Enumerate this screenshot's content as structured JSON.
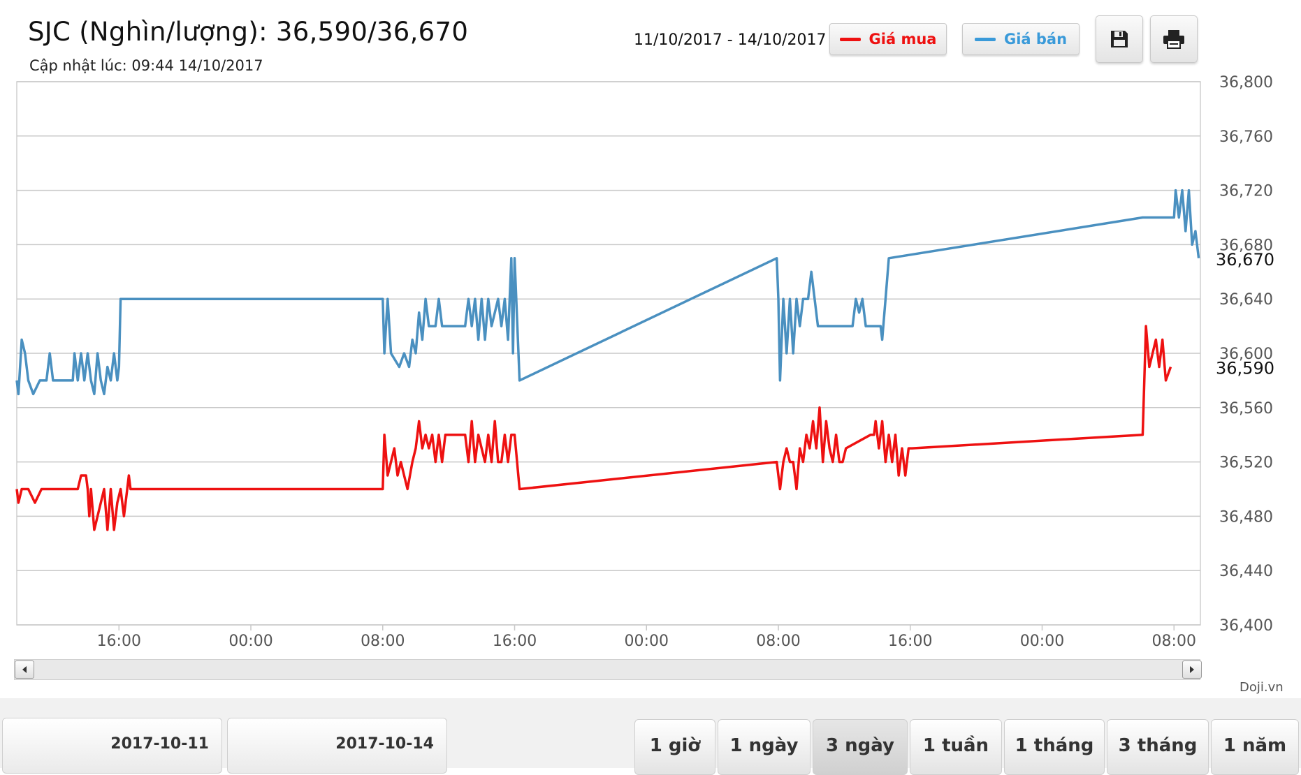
{
  "header": {
    "title": "SJC (Nghìn/lượng): 36,590/36,670",
    "updated": "Cập nhật lúc: 09:44 14/10/2017",
    "date_range": "11/10/2017 - 14/10/2017"
  },
  "legend": {
    "buy_label": "Giá mua",
    "sell_label": "Giá bán",
    "buy_color": "#ee1111",
    "sell_color": "#4a90c0"
  },
  "toolbar": {
    "save_icon": "floppy-disk-icon",
    "print_icon": "printer-icon"
  },
  "credit": "Doji.vn",
  "navigator": {
    "from": "2017-10-11",
    "to": "2017-10-14"
  },
  "range_buttons": [
    "1 giờ",
    "1 ngày",
    "3 ngày",
    "1 tuần",
    "1 tháng",
    "3 tháng",
    "1 năm"
  ],
  "active_range": "3 ngày",
  "chart_data": {
    "type": "line",
    "x_unit": "hours since 2017-10-11 00:00",
    "ylim": [
      36400,
      36800
    ],
    "y_ticks": [
      36400,
      36440,
      36480,
      36520,
      36560,
      36600,
      36640,
      36680,
      36720,
      36760,
      36800
    ],
    "y_tick_labels": [
      "36,400",
      "36,440",
      "36,480",
      "36,520",
      "36,560",
      "36,600",
      "36,640",
      "36,680",
      "36,720",
      "36,760",
      "36,800"
    ],
    "x_ticks": [
      16,
      24,
      32,
      40,
      48,
      56,
      64,
      72,
      80
    ],
    "x_tick_labels": [
      "16:00",
      "00:00",
      "08:00",
      "16:00",
      "00:00",
      "08:00",
      "16:00",
      "00:00",
      "08:00"
    ],
    "x_range": [
      9.8,
      81.6
    ],
    "last_values": {
      "sell": "36,670",
      "buy": "36,590"
    },
    "grid": true,
    "series": [
      {
        "name": "Giá bán",
        "color": "#4a90c0",
        "points": [
          [
            9.8,
            36580
          ],
          [
            9.9,
            36570
          ],
          [
            10.1,
            36610
          ],
          [
            10.3,
            36600
          ],
          [
            10.5,
            36580
          ],
          [
            10.8,
            36570
          ],
          [
            11.2,
            36580
          ],
          [
            11.6,
            36580
          ],
          [
            11.8,
            36600
          ],
          [
            12.0,
            36580
          ],
          [
            13.2,
            36580
          ],
          [
            13.3,
            36600
          ],
          [
            13.5,
            36580
          ],
          [
            13.7,
            36600
          ],
          [
            13.9,
            36580
          ],
          [
            14.1,
            36600
          ],
          [
            14.3,
            36580
          ],
          [
            14.5,
            36570
          ],
          [
            14.7,
            36600
          ],
          [
            14.9,
            36580
          ],
          [
            15.1,
            36570
          ],
          [
            15.3,
            36590
          ],
          [
            15.5,
            36580
          ],
          [
            15.7,
            36600
          ],
          [
            15.9,
            36580
          ],
          [
            16.0,
            36590
          ],
          [
            16.1,
            36640
          ],
          [
            32.0,
            36640
          ],
          [
            32.1,
            36600
          ],
          [
            32.3,
            36640
          ],
          [
            32.5,
            36600
          ],
          [
            33.0,
            36590
          ],
          [
            33.3,
            36600
          ],
          [
            33.6,
            36590
          ],
          [
            33.8,
            36610
          ],
          [
            34.0,
            36600
          ],
          [
            34.2,
            36630
          ],
          [
            34.4,
            36610
          ],
          [
            34.6,
            36640
          ],
          [
            34.8,
            36620
          ],
          [
            35.2,
            36620
          ],
          [
            35.4,
            36640
          ],
          [
            35.6,
            36620
          ],
          [
            37.0,
            36620
          ],
          [
            37.2,
            36640
          ],
          [
            37.4,
            36620
          ],
          [
            37.6,
            36640
          ],
          [
            37.8,
            36610
          ],
          [
            38.0,
            36640
          ],
          [
            38.2,
            36610
          ],
          [
            38.4,
            36640
          ],
          [
            38.6,
            36620
          ],
          [
            39.0,
            36640
          ],
          [
            39.2,
            36620
          ],
          [
            39.4,
            36640
          ],
          [
            39.6,
            36610
          ],
          [
            39.8,
            36670
          ],
          [
            39.9,
            36600
          ],
          [
            40.0,
            36670
          ],
          [
            40.3,
            36580
          ],
          [
            55.9,
            36670
          ],
          [
            56.0,
            36640
          ],
          [
            56.1,
            36580
          ],
          [
            56.3,
            36640
          ],
          [
            56.5,
            36600
          ],
          [
            56.7,
            36640
          ],
          [
            56.9,
            36600
          ],
          [
            57.1,
            36640
          ],
          [
            57.3,
            36620
          ],
          [
            57.5,
            36640
          ],
          [
            57.8,
            36640
          ],
          [
            58.0,
            36660
          ],
          [
            58.2,
            36640
          ],
          [
            58.4,
            36620
          ],
          [
            59.2,
            36620
          ],
          [
            60.5,
            36620
          ],
          [
            60.7,
            36640
          ],
          [
            60.9,
            36630
          ],
          [
            61.1,
            36640
          ],
          [
            61.3,
            36620
          ],
          [
            62.2,
            36620
          ],
          [
            62.3,
            36610
          ],
          [
            62.5,
            36640
          ],
          [
            62.7,
            36670
          ],
          [
            78.1,
            36700
          ],
          [
            80.0,
            36700
          ],
          [
            80.1,
            36720
          ],
          [
            80.3,
            36700
          ],
          [
            80.5,
            36720
          ],
          [
            80.7,
            36690
          ],
          [
            80.9,
            36720
          ],
          [
            81.1,
            36680
          ],
          [
            81.3,
            36690
          ],
          [
            81.5,
            36670
          ]
        ]
      },
      {
        "name": "Giá mua",
        "color": "#ee1111",
        "points": [
          [
            9.8,
            36500
          ],
          [
            9.9,
            36490
          ],
          [
            10.1,
            36500
          ],
          [
            10.5,
            36500
          ],
          [
            10.9,
            36490
          ],
          [
            11.3,
            36500
          ],
          [
            13.5,
            36500
          ],
          [
            13.7,
            36510
          ],
          [
            14.0,
            36510
          ],
          [
            14.1,
            36500
          ],
          [
            14.2,
            36480
          ],
          [
            14.3,
            36500
          ],
          [
            14.5,
            36470
          ],
          [
            14.7,
            36480
          ],
          [
            14.9,
            36490
          ],
          [
            15.1,
            36500
          ],
          [
            15.3,
            36470
          ],
          [
            15.5,
            36500
          ],
          [
            15.7,
            36470
          ],
          [
            15.9,
            36490
          ],
          [
            16.1,
            36500
          ],
          [
            16.3,
            36480
          ],
          [
            16.5,
            36500
          ],
          [
            16.6,
            36510
          ],
          [
            16.7,
            36500
          ],
          [
            32.0,
            36500
          ],
          [
            32.1,
            36540
          ],
          [
            32.3,
            36510
          ],
          [
            32.5,
            36520
          ],
          [
            32.7,
            36530
          ],
          [
            32.9,
            36510
          ],
          [
            33.1,
            36520
          ],
          [
            33.3,
            36510
          ],
          [
            33.5,
            36500
          ],
          [
            33.8,
            36520
          ],
          [
            34.0,
            36530
          ],
          [
            34.2,
            36550
          ],
          [
            34.4,
            36530
          ],
          [
            34.6,
            36540
          ],
          [
            34.8,
            36530
          ],
          [
            35.0,
            36540
          ],
          [
            35.2,
            36520
          ],
          [
            35.4,
            36540
          ],
          [
            35.6,
            36520
          ],
          [
            35.8,
            36540
          ],
          [
            37.0,
            36540
          ],
          [
            37.2,
            36520
          ],
          [
            37.4,
            36550
          ],
          [
            37.6,
            36520
          ],
          [
            37.8,
            36540
          ],
          [
            38.0,
            36530
          ],
          [
            38.2,
            36520
          ],
          [
            38.4,
            36540
          ],
          [
            38.6,
            36520
          ],
          [
            38.8,
            36550
          ],
          [
            39.0,
            36520
          ],
          [
            39.2,
            36520
          ],
          [
            39.4,
            36540
          ],
          [
            39.6,
            36520
          ],
          [
            39.8,
            36540
          ],
          [
            40.0,
            36540
          ],
          [
            40.3,
            36500
          ],
          [
            55.9,
            36520
          ],
          [
            56.0,
            36510
          ],
          [
            56.1,
            36500
          ],
          [
            56.3,
            36520
          ],
          [
            56.5,
            36530
          ],
          [
            56.7,
            36520
          ],
          [
            56.9,
            36520
          ],
          [
            57.1,
            36500
          ],
          [
            57.3,
            36530
          ],
          [
            57.5,
            36520
          ],
          [
            57.7,
            36540
          ],
          [
            57.9,
            36530
          ],
          [
            58.1,
            36550
          ],
          [
            58.3,
            36530
          ],
          [
            58.5,
            36560
          ],
          [
            58.7,
            36520
          ],
          [
            58.9,
            36550
          ],
          [
            59.1,
            36530
          ],
          [
            59.3,
            36520
          ],
          [
            59.5,
            36540
          ],
          [
            59.7,
            36520
          ],
          [
            59.9,
            36520
          ],
          [
            60.1,
            36530
          ],
          [
            61.6,
            36540
          ],
          [
            61.8,
            36540
          ],
          [
            61.9,
            36550
          ],
          [
            62.1,
            36530
          ],
          [
            62.3,
            36550
          ],
          [
            62.5,
            36520
          ],
          [
            62.7,
            36540
          ],
          [
            62.9,
            36520
          ],
          [
            63.1,
            36540
          ],
          [
            63.3,
            36510
          ],
          [
            63.5,
            36530
          ],
          [
            63.7,
            36510
          ],
          [
            63.9,
            36530
          ],
          [
            64.1,
            36530
          ],
          [
            78.1,
            36540
          ],
          [
            78.3,
            36620
          ],
          [
            78.5,
            36590
          ],
          [
            78.7,
            36600
          ],
          [
            78.9,
            36610
          ],
          [
            79.1,
            36590
          ],
          [
            79.3,
            36610
          ],
          [
            79.5,
            36580
          ],
          [
            79.8,
            36590
          ]
        ]
      }
    ]
  }
}
